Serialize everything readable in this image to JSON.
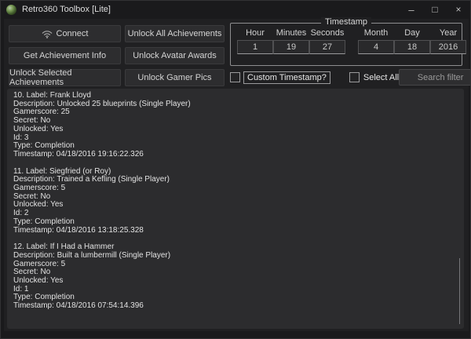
{
  "window": {
    "title": "Retro360 Toolbox [Lite]",
    "controls": {
      "minimize_glyph": "–",
      "maximize_glyph": "□",
      "close_glyph": "×"
    }
  },
  "buttons": {
    "connect": "Connect",
    "get_achievement_info": "Get Achievement Info",
    "unlock_selected": "Unlock Selected Achievements",
    "unlock_all": "Unlock All Achievements",
    "unlock_avatar_awards": "Unlock Avatar Awards",
    "unlock_gamer_pics": "Unlock Gamer Pics"
  },
  "timestamp_panel": {
    "title": "Timestamp",
    "fields": [
      {
        "label": "Hour",
        "value": "1"
      },
      {
        "label": "Minutes",
        "value": "19"
      },
      {
        "label": "Seconds",
        "value": "27"
      },
      {
        "label": "Month",
        "value": "4"
      },
      {
        "label": "Day",
        "value": "18"
      },
      {
        "label": "Year",
        "value": "2016"
      }
    ]
  },
  "options": {
    "custom_timestamp_label": "Custom Timestamp?",
    "select_all_label": "Select All"
  },
  "search": {
    "placeholder": "Search filter"
  },
  "achievement_log": {
    "field_labels": {
      "label": "Label",
      "description": "Description",
      "gamerscore": "Gamerscore",
      "secret": "Secret",
      "unlocked": "Unlocked",
      "id": "Id",
      "type": "Type",
      "timestamp": "Timestamp"
    },
    "entries": [
      {
        "number": "10",
        "label": "Frank Lloyd",
        "description": "Unlocked 25 blueprints (Single Player)",
        "gamerscore": "25",
        "secret": "No",
        "unlocked": "Yes",
        "id": "3",
        "type": "Completion",
        "timestamp": "04/18/2016 19:16:22.326"
      },
      {
        "number": "11",
        "label": "Siegfried (or Roy)",
        "description": "Trained a Kefling (Single Player)",
        "gamerscore": "5",
        "secret": "No",
        "unlocked": "Yes",
        "id": "2",
        "type": "Completion",
        "timestamp": "04/18/2016 13:18:25.328"
      },
      {
        "number": "12",
        "label": "If I Had a Hammer",
        "description": "Built a lumbermill (Single Player)",
        "gamerscore": "5",
        "secret": "No",
        "unlocked": "Yes",
        "id": "1",
        "type": "Completion",
        "timestamp": "04/18/2016 07:54:14.396"
      }
    ]
  }
}
